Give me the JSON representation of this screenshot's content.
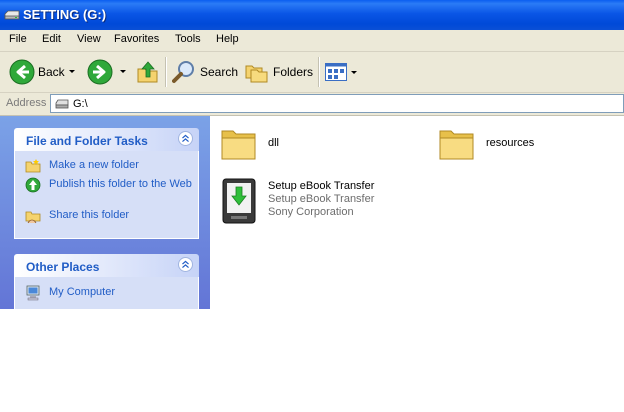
{
  "window": {
    "title": "SETTING (G:)"
  },
  "menu": [
    "File",
    "Edit",
    "View",
    "Favorites",
    "Tools",
    "Help"
  ],
  "toolbar": {
    "back": "Back",
    "search": "Search",
    "folders": "Folders"
  },
  "address": {
    "label": "Address",
    "value": "G:\\"
  },
  "tasks": {
    "file_folder": {
      "title": "File and Folder Tasks",
      "items": [
        {
          "label": "Make a new folder",
          "icon": "new-folder-icon"
        },
        {
          "label": "Publish this folder to the Web",
          "icon": "publish-web-icon"
        },
        {
          "label": "Share this folder",
          "icon": "share-folder-icon"
        }
      ]
    },
    "other_places": {
      "title": "Other Places",
      "items": [
        {
          "label": "My Computer",
          "icon": "my-computer-icon"
        }
      ]
    }
  },
  "files": [
    {
      "name": "dll",
      "icon": "folder-icon"
    },
    {
      "name": "resources",
      "icon": "folder-icon"
    },
    {
      "name": "Setup eBook Transfer",
      "description": "Setup eBook Transfer",
      "company": "Sony Corporation",
      "icon": "installer-icon"
    }
  ],
  "colors": {
    "titlebar": "#0a56e6",
    "task_link": "#215dc6",
    "task_pane": "#7ba2e7",
    "chrome": "#ece9d8"
  }
}
